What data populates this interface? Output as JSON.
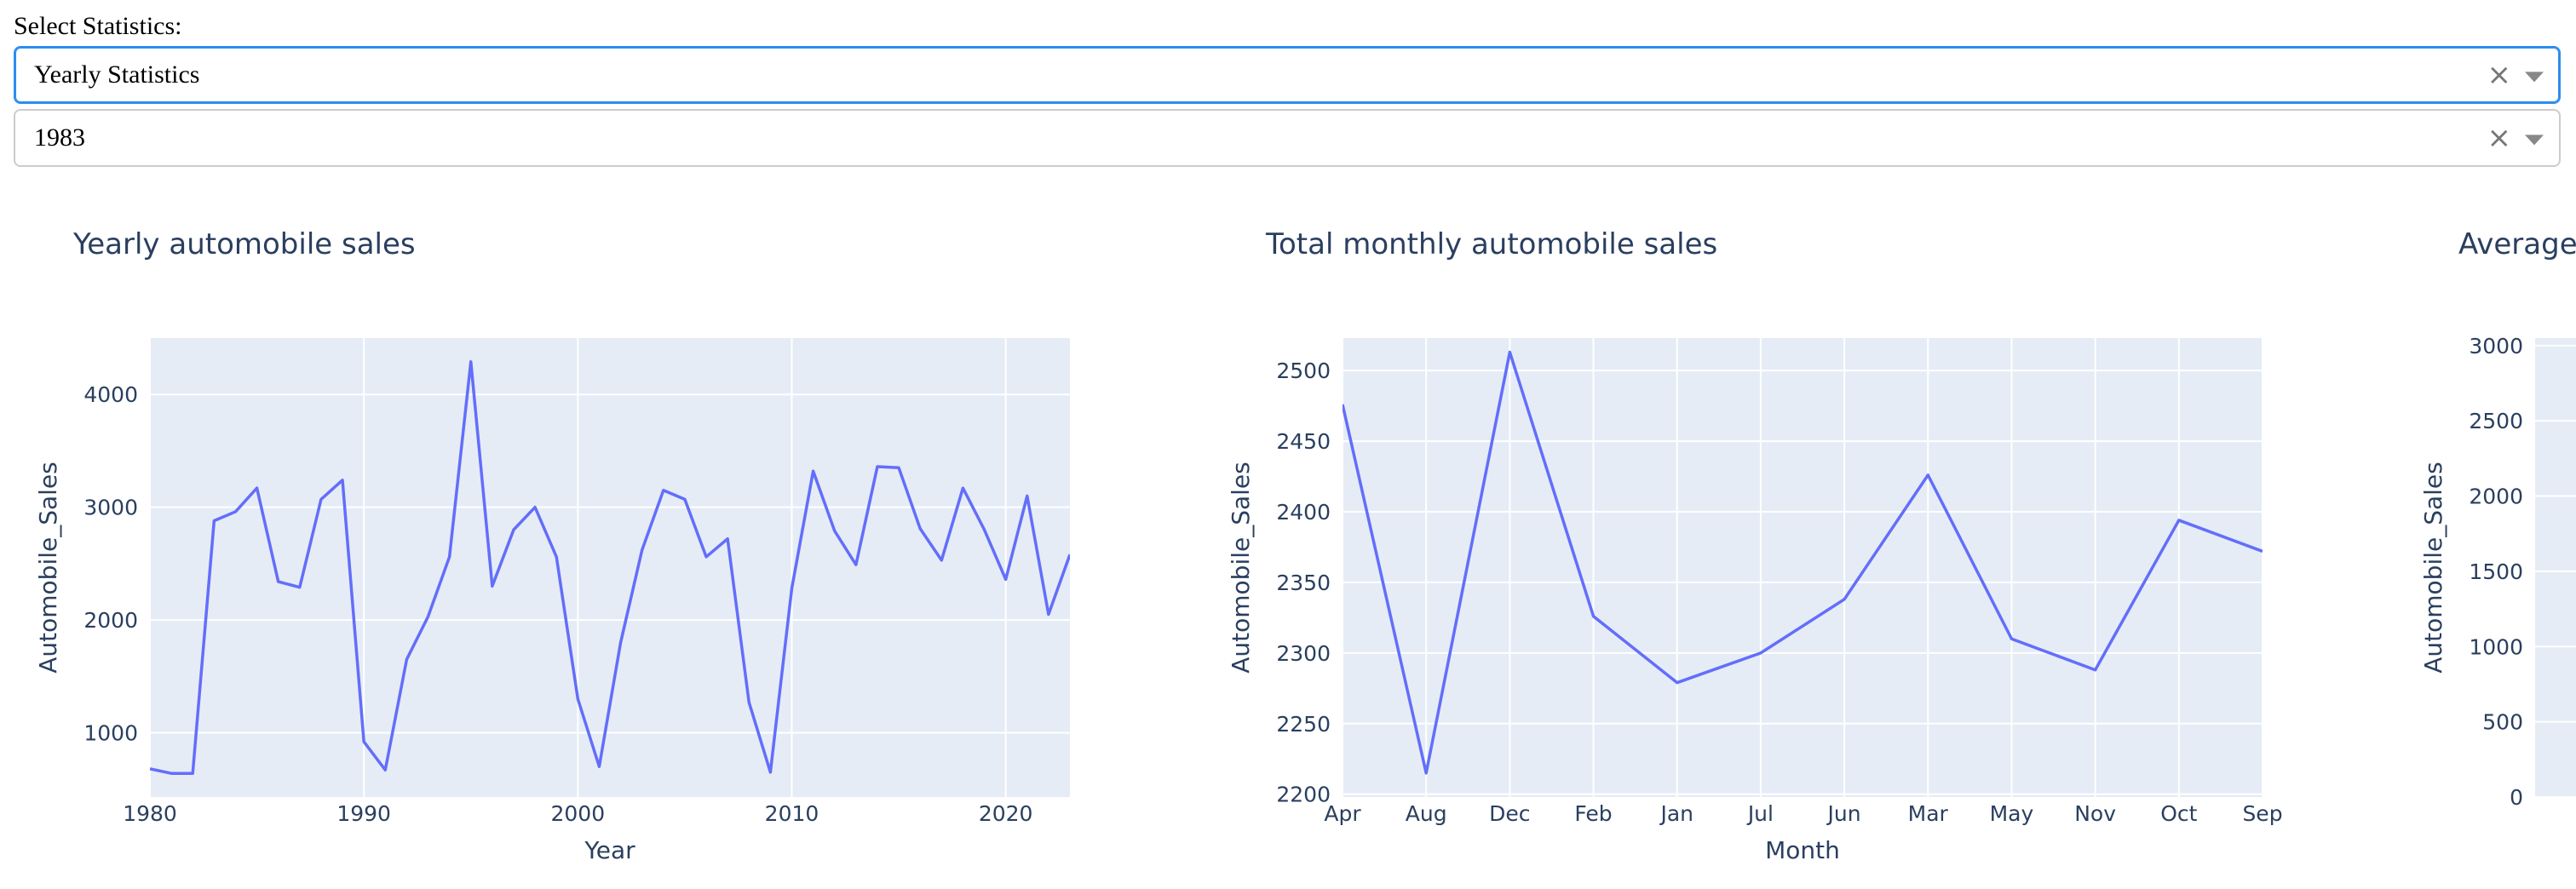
{
  "form": {
    "label": "Select Statistics:",
    "dropdown_statistics": {
      "value": "Yearly Statistics"
    },
    "dropdown_year": {
      "value": "1983"
    },
    "clear_glyph": "×"
  },
  "colors": {
    "line": "#636efa",
    "plot_bg": "#e5ecf6",
    "grid": "#ffffff",
    "text": "#2a3f5f",
    "focus_border": "#2d8cf0"
  },
  "icons": [
    "clear-icon",
    "chevron-down-icon"
  ],
  "chart_data": [
    {
      "type": "line",
      "title": "Yearly automobile sales",
      "xlabel": "Year",
      "ylabel": "Automobile_Sales",
      "xlim": [
        1980,
        2023
      ],
      "ylim": [
        430,
        4500
      ],
      "xticks": [
        1980,
        1990,
        2000,
        2010,
        2020
      ],
      "yticks": [
        1000,
        2000,
        3000,
        4000
      ],
      "grid": true,
      "series": [
        {
          "x": [
            1980,
            1981,
            1982,
            1983,
            1984,
            1985,
            1986,
            1987,
            1988,
            1989,
            1990,
            1991,
            1992,
            1993,
            1994,
            1995,
            1996,
            1997,
            1998,
            1999,
            2000,
            2001,
            2002,
            2003,
            2004,
            2005,
            2006,
            2007,
            2008,
            2009,
            2010,
            2011,
            2012,
            2013,
            2014,
            2015,
            2016,
            2017,
            2018,
            2019,
            2020,
            2021,
            2022,
            2023
          ],
          "y": [
            680,
            640,
            640,
            2880,
            2960,
            3170,
            2340,
            2290,
            3070,
            3240,
            920,
            670,
            1650,
            2030,
            2560,
            4290,
            2300,
            2800,
            3000,
            2560,
            1300,
            700,
            1800,
            2620,
            3150,
            3070,
            2560,
            2720,
            1270,
            650,
            2280,
            3320,
            2790,
            2490,
            3360,
            3350,
            2810,
            2530,
            3170,
            2800,
            2360,
            3100,
            2050,
            2580
          ]
        }
      ]
    },
    {
      "type": "line",
      "title": "Total monthly automobile sales",
      "xlabel": "Month",
      "ylabel": "Automobile_Sales",
      "categories": [
        "Apr",
        "Aug",
        "Dec",
        "Feb",
        "Jan",
        "Jul",
        "Jun",
        "Mar",
        "May",
        "Nov",
        "Oct",
        "Sep"
      ],
      "ylim": [
        2198,
        2523
      ],
      "yticks": [
        2200,
        2250,
        2300,
        2350,
        2400,
        2450,
        2500
      ],
      "grid": true,
      "series": [
        {
          "values": [
            2476,
            2215,
            2513,
            2326,
            2279,
            2300,
            2338,
            2426,
            2310,
            2288,
            2394,
            2372
          ]
        }
      ]
    },
    {
      "type": "bar",
      "title": "Average",
      "ylabel": "Automobile_Sales",
      "ylim": [
        0,
        3050
      ],
      "yticks": [
        0,
        500,
        1000,
        1500,
        2000,
        2500,
        3000
      ],
      "grid": true
    }
  ]
}
